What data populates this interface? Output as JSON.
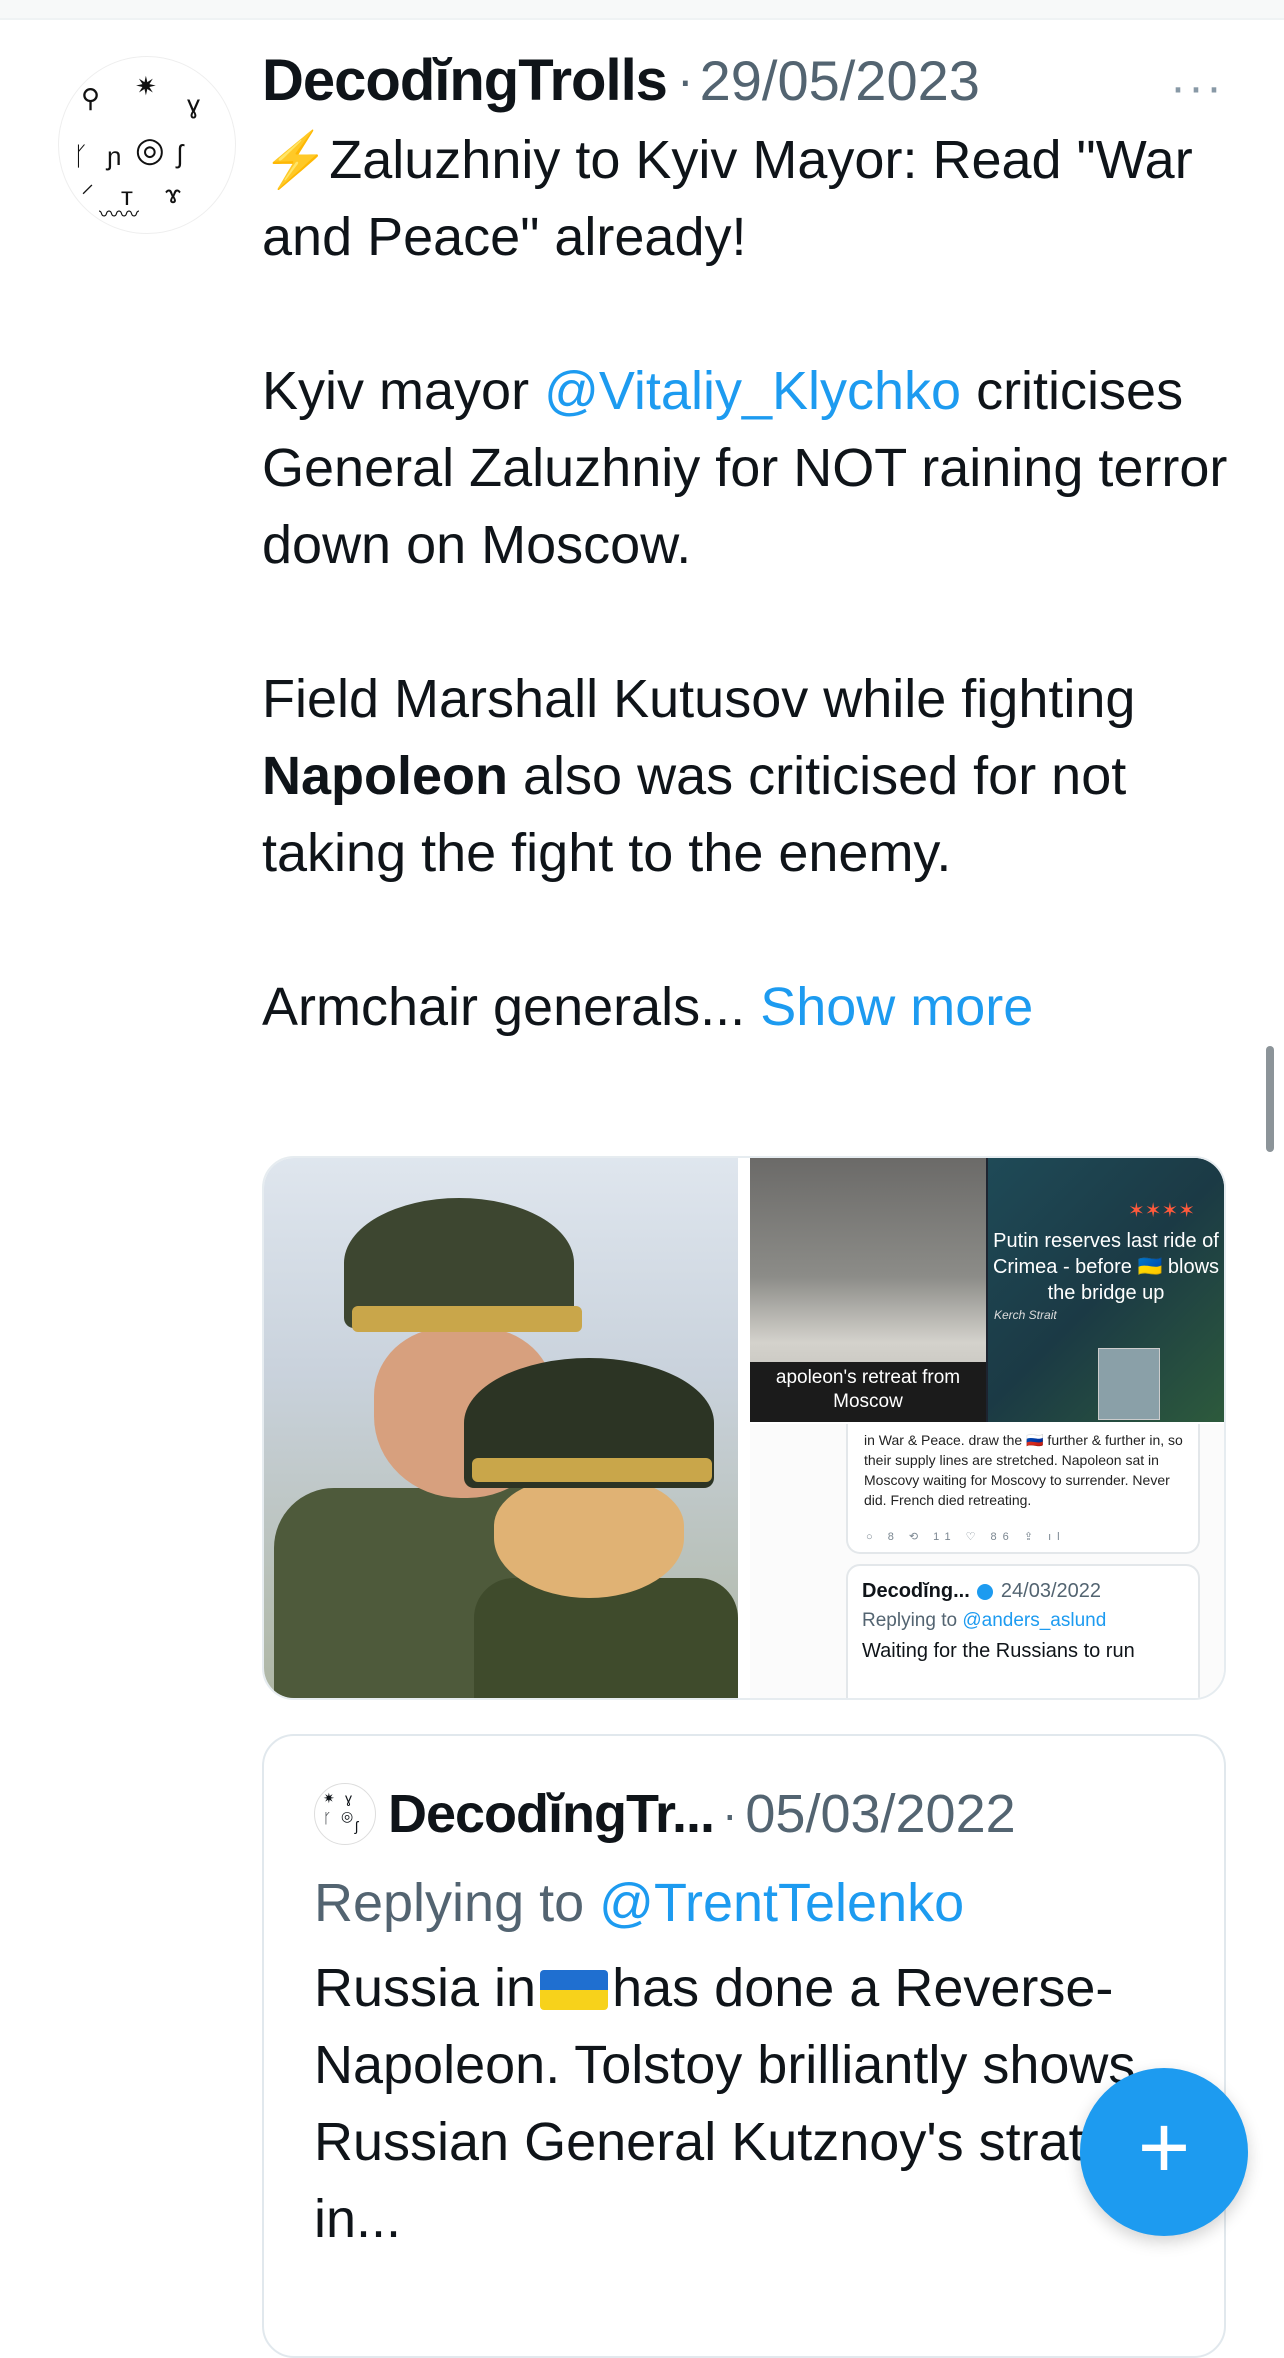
{
  "tweet": {
    "author_name": "DecodĭngTrolls",
    "separator": "·",
    "date": "29/05/2023",
    "more_label": "···",
    "line1_icon": "⚡",
    "line1_text": "Zaluzhniy to Kyiv Mayor: Read \"War and Peace\" already!",
    "p2_pre": "Kyiv mayor ",
    "p2_mention": "@Vitaliy_Klychko",
    "p2_post": " criticises General Zaluzhniy for NOT raining terror down on Moscow.",
    "p3_pre": "Field Marshall Kutusov while fighting ",
    "p3_bold": "Napoleon",
    "p3_post": " also was criticised for not taking the fight to the enemy.",
    "p4_text": "Armchair generals... ",
    "show_more": "Show more"
  },
  "media": {
    "caption_painting": "apoleon's retreat from Moscow",
    "map_caption": "Putin reserves last ride of Crimea - before 🇺🇦 blows the bridge up",
    "map_stars": "✶✶✶✶",
    "map_small": "Kerch Strait",
    "embedded_tweet1_text": "in War & Peace. draw the 🇷🇺 further & further in, so their supply lines are stretched. Napoleon sat in Moscovy waiting for Moscovy to surrender. Never did. French died retreating.",
    "embedded_tweet1_actions": "○ 8  ⟲ 11  ♡ 86  ⇪  ıl",
    "embedded_tweet2_name": "Decodĭng...",
    "embedded_tweet2_date": "24/03/2022",
    "embedded_tweet2_reply_pre": "Replying to ",
    "embedded_tweet2_reply_mention": "@anders_aslund",
    "embedded_tweet2_text": "Waiting for the Russians to run"
  },
  "quoted": {
    "author_name": "DecodĭngTr...",
    "separator": "·",
    "date": "05/03/2022",
    "reply_pre": "Replying to ",
    "reply_mention": "@TrentTelenko",
    "text_pre": "Russia in",
    "text_post": "has done a Reverse-Napoleon. Tolstoy brilliantly shows Russian General Kutznoy's strategy in..."
  },
  "fab": {
    "label": "+"
  },
  "colors": {
    "accent": "#1d9bf0",
    "text": "#0f1419",
    "muted": "#536471"
  },
  "icons": {
    "more": "more-icon",
    "compose": "plus-icon",
    "flag": "ukraine-flag-icon",
    "bolt": "lightning-icon"
  }
}
